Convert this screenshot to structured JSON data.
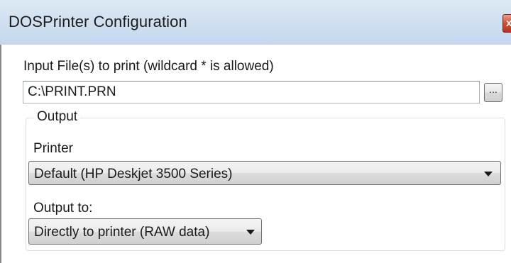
{
  "window": {
    "title": "DOSPrinter Configuration",
    "close_label": "x"
  },
  "input_files": {
    "label": "Input File(s) to print (wildcard * is allowed)",
    "value": "C:\\PRINT.PRN",
    "browse_label": "..."
  },
  "output_group": {
    "legend": "Output",
    "printer": {
      "label": "Printer",
      "selected": "Default (HP Deskjet 3500 Series)"
    },
    "output_to": {
      "label": "Output to:",
      "selected": "Directly to printer (RAW data)"
    }
  }
}
